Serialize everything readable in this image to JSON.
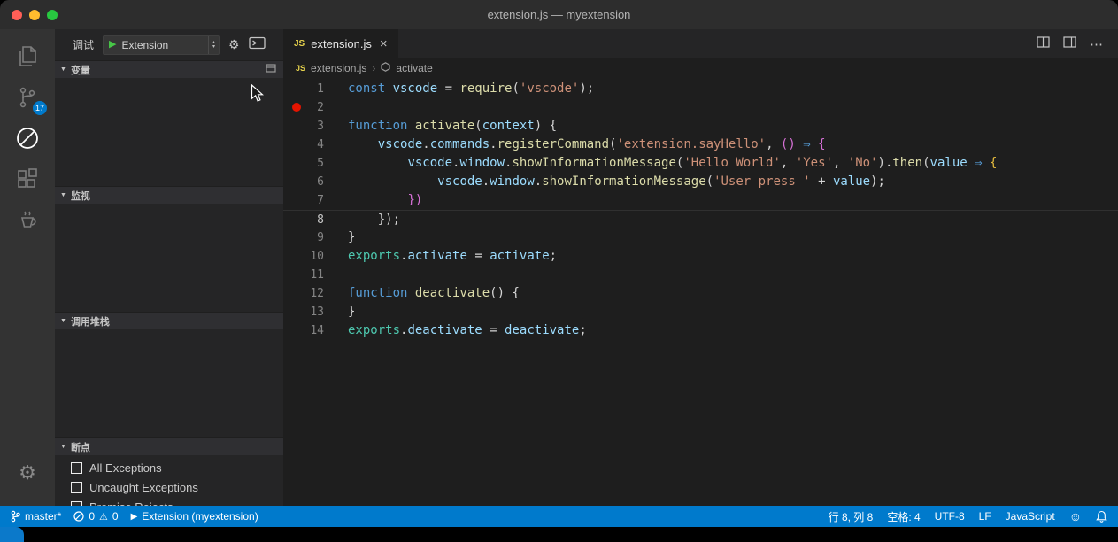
{
  "window": {
    "title": "extension.js — myextension",
    "traffic_lights": {
      "close": "#ff5f57",
      "minimize": "#febc2e",
      "zoom": "#28c840"
    }
  },
  "activity_bar": {
    "scm_badge": "17"
  },
  "sidebar": {
    "title": "调试",
    "config": "Extension",
    "sections": {
      "variables": "变量",
      "watch": "监视",
      "call_stack": "调用堆栈",
      "breakpoints": "断点"
    },
    "breakpoints": [
      "All Exceptions",
      "Uncaught Exceptions",
      "Promise Rejects"
    ]
  },
  "editor": {
    "tab": "extension.js",
    "breadcrumb": {
      "file": "extension.js",
      "symbol": "activate"
    },
    "lines": [
      {
        "n": 1,
        "tokens": [
          [
            "const ",
            "kw"
          ],
          [
            "vscode",
            "var"
          ],
          [
            " = ",
            "fg"
          ],
          [
            "require",
            "fn"
          ],
          [
            "(",
            "fg"
          ],
          [
            "'vscode'",
            "str"
          ],
          [
            ");",
            "fg"
          ]
        ]
      },
      {
        "n": 2,
        "breakpoint": true,
        "tokens": []
      },
      {
        "n": 3,
        "tokens": [
          [
            "function ",
            "kw"
          ],
          [
            "activate",
            "fn"
          ],
          [
            "(",
            "fg"
          ],
          [
            "context",
            "var"
          ],
          [
            ") {",
            "fg"
          ]
        ]
      },
      {
        "n": 4,
        "tokens": [
          [
            "    ",
            "fg"
          ],
          [
            "vscode",
            "var"
          ],
          [
            ".",
            "fg"
          ],
          [
            "commands",
            "var"
          ],
          [
            ".",
            "fg"
          ],
          [
            "registerCommand",
            "fn"
          ],
          [
            "(",
            "fg"
          ],
          [
            "'extension.sayHello'",
            "str"
          ],
          [
            ", ",
            "fg"
          ],
          [
            "()",
            "pink"
          ],
          [
            " ",
            "fg"
          ],
          [
            "⇒",
            "kw"
          ],
          [
            " {",
            "pink"
          ]
        ]
      },
      {
        "n": 5,
        "tokens": [
          [
            "        ",
            "fg"
          ],
          [
            "vscode",
            "var"
          ],
          [
            ".",
            "fg"
          ],
          [
            "window",
            "var"
          ],
          [
            ".",
            "fg"
          ],
          [
            "showInformationMessage",
            "fn"
          ],
          [
            "(",
            "fg"
          ],
          [
            "'Hello World'",
            "str"
          ],
          [
            ", ",
            "fg"
          ],
          [
            "'Yes'",
            "str"
          ],
          [
            ", ",
            "fg"
          ],
          [
            "'No'",
            "str"
          ],
          [
            ").",
            "fg"
          ],
          [
            "then",
            "fn"
          ],
          [
            "(",
            "fg"
          ],
          [
            "value",
            "var"
          ],
          [
            " ",
            "fg"
          ],
          [
            "⇒",
            "kw"
          ],
          [
            " {",
            "gold"
          ]
        ]
      },
      {
        "n": 6,
        "tokens": [
          [
            "            ",
            "fg"
          ],
          [
            "vscode",
            "var"
          ],
          [
            ".",
            "fg"
          ],
          [
            "window",
            "var"
          ],
          [
            ".",
            "fg"
          ],
          [
            "showInformationMessage",
            "fn"
          ],
          [
            "(",
            "fg"
          ],
          [
            "'User press '",
            "str"
          ],
          [
            " + ",
            "fg"
          ],
          [
            "value",
            "var"
          ],
          [
            ");",
            "fg"
          ]
        ]
      },
      {
        "n": 7,
        "tokens": [
          [
            "        ",
            "fg"
          ],
          [
            "})",
            "pink"
          ]
        ]
      },
      {
        "n": 8,
        "current": true,
        "tokens": [
          [
            "    ",
            "fg"
          ],
          [
            "});",
            "fg"
          ]
        ]
      },
      {
        "n": 9,
        "tokens": [
          [
            "}",
            "fg"
          ]
        ]
      },
      {
        "n": 10,
        "tokens": [
          [
            "exports",
            "teal"
          ],
          [
            ".",
            "fg"
          ],
          [
            "activate",
            "var"
          ],
          [
            " = ",
            "fg"
          ],
          [
            "activate",
            "var"
          ],
          [
            ";",
            "fg"
          ]
        ]
      },
      {
        "n": 11,
        "tokens": []
      },
      {
        "n": 12,
        "tokens": [
          [
            "function ",
            "kw"
          ],
          [
            "deactivate",
            "fn"
          ],
          [
            "() {",
            "fg"
          ]
        ]
      },
      {
        "n": 13,
        "tokens": [
          [
            "}",
            "fg"
          ]
        ]
      },
      {
        "n": 14,
        "tokens": [
          [
            "exports",
            "teal"
          ],
          [
            ".",
            "fg"
          ],
          [
            "deactivate",
            "var"
          ],
          [
            " = ",
            "fg"
          ],
          [
            "deactivate",
            "var"
          ],
          [
            ";",
            "fg"
          ]
        ]
      }
    ]
  },
  "status_bar": {
    "branch": "master*",
    "errors": "0",
    "warnings": "0",
    "debug_target": "Extension (myextension)",
    "cursor_position": "行 8, 列 8",
    "indentation": "空格: 4",
    "encoding": "UTF-8",
    "eol": "LF",
    "language": "JavaScript"
  },
  "icons": {
    "close_tab": "×",
    "ellipsis": "⋯",
    "play": "▶",
    "gear": "⚙",
    "smiley": "☺",
    "warning": "⚠",
    "twisty": "▼",
    "chevron": "›",
    "js_badge": "JS",
    "arrow_up": "▴",
    "arrow_down": "▾"
  },
  "colors": {
    "kw": "#569cd6",
    "var": "#9cdcfe",
    "fn": "#dcdcaa",
    "str": "#ce9178",
    "fg": "#d4d4d4",
    "teal": "#4ec9b0",
    "pink": "#d670d6",
    "gold": "#e2b93d",
    "statusbar": "#007acc",
    "breakpoint": "#e51400",
    "badge": "#007acc",
    "js_icon": "#e8d44d"
  }
}
